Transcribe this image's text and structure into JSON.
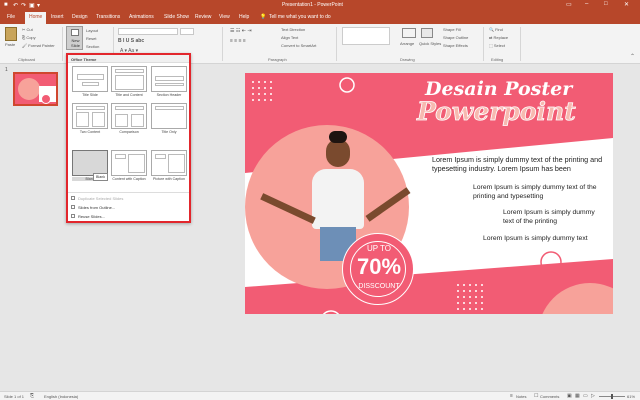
{
  "window": {
    "title": "Presentation1 - PowerPoint"
  },
  "tabs": [
    "File",
    "Home",
    "Insert",
    "Design",
    "Transitions",
    "Animations",
    "Slide Show",
    "Review",
    "View",
    "Help"
  ],
  "tellme": "Tell me what you want to do",
  "ribbon": {
    "paste": "Paste",
    "cut": "Cut",
    "copy": "Copy",
    "format_painter": "Format Painter",
    "clipboard": "Clipboard",
    "new_slide": "New Slide",
    "layout": "Layout",
    "reset": "Reset",
    "section": "Section",
    "paragraph": "Paragraph",
    "text_direction": "Text Direction",
    "align_text": "Align Text",
    "convert_smartart": "Convert to SmartArt",
    "arrange": "Arrange",
    "quick_styles": "Quick Styles",
    "shape_fill": "Shape Fill",
    "shape_outline": "Shape Outline",
    "shape_effects": "Shape Effects",
    "drawing": "Drawing",
    "find": "Find",
    "replace": "Replace",
    "select": "Select",
    "editing": "Editing"
  },
  "layout_menu": {
    "header": "Office Theme",
    "layouts": [
      "Title Slide",
      "Title and Content",
      "Section Header",
      "Two Content",
      "Comparison",
      "Title Only",
      "Blank",
      "Content with Caption",
      "Picture with Caption"
    ],
    "tooltip": "Blank",
    "items": [
      "Duplicate Selected Slides",
      "Slides from Outline...",
      "Reuse Slides..."
    ]
  },
  "slide_panel": {
    "number": "1"
  },
  "slide": {
    "title1": "Desain Poster",
    "title2": "Powerpoint",
    "para1": "Lorem Ipsum is simply dummy text of the printing and typesetting industry. Lorem Ipsum has been",
    "para2": "Lorem Ipsum is simply dummy text of the printing and typesetting",
    "para3": "Lorem Ipsum is simply dummy text of the printing",
    "para4": "Lorem Ipsum is simply dummy text",
    "badge_top": "UP TO",
    "badge_mid": "70%",
    "badge_bot": "DISSCOUNT"
  },
  "status": {
    "slide": "Slide 1 of 1",
    "language": "English (Indonesia)",
    "notes": "Notes",
    "comments": "Comments",
    "zoom": "61%"
  },
  "colors": {
    "brand": "#b7472a",
    "slide": "#f25c74",
    "peach": "#f7a29a"
  }
}
